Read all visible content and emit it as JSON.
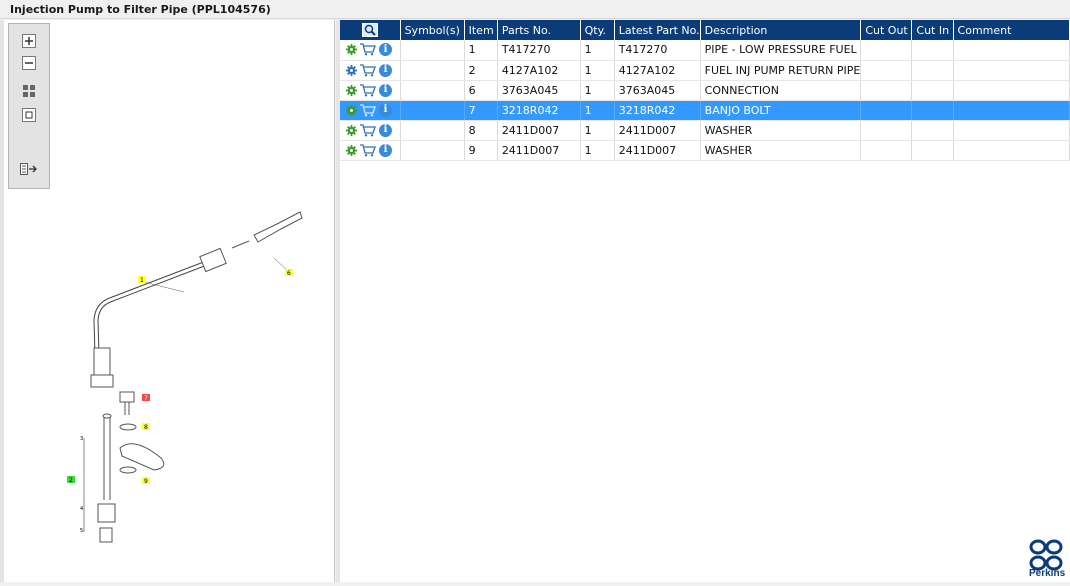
{
  "window": {
    "title": "Injection Pump to Filter Pipe (PPL104576)"
  },
  "zoom_tools": [
    {
      "name": "zoom-in-icon"
    },
    {
      "name": "zoom-out-icon"
    },
    {
      "name": "fit-all-icon"
    },
    {
      "name": "fit-window-icon"
    },
    {
      "name": "export-icon"
    }
  ],
  "diagram": {
    "callouts": [
      "1",
      "6",
      "7",
      "8",
      "9",
      "2",
      "3",
      "4",
      "5"
    ],
    "highlighted_callout": "7",
    "group_callout": "2",
    "colors": {
      "callout_yellow": "#ffff33",
      "callout_red": "#ff4444",
      "callout_green": "#33dd33",
      "line": "#555555"
    }
  },
  "grid": {
    "columns": [
      "",
      "Symbol(s)",
      "Item",
      "Parts No.",
      "Qty.",
      "Latest Part No.",
      "Description",
      "Cut Out",
      "Cut In",
      "Comment"
    ],
    "rows": [
      {
        "gear": "green",
        "symbols": "",
        "item": "1",
        "part_no": "T417270",
        "qty": "1",
        "latest": "T417270",
        "description": "PIPE - LOW PRESSURE FUEL",
        "cut_out": "",
        "cut_in": "",
        "comment": ""
      },
      {
        "gear": "blue",
        "symbols": "",
        "item": "2",
        "part_no": "4127A102",
        "qty": "1",
        "latest": "4127A102",
        "description": "FUEL INJ PUMP RETURN PIPE",
        "cut_out": "",
        "cut_in": "",
        "comment": ""
      },
      {
        "gear": "green",
        "symbols": "",
        "item": "6",
        "part_no": "3763A045",
        "qty": "1",
        "latest": "3763A045",
        "description": "CONNECTION",
        "cut_out": "",
        "cut_in": "",
        "comment": ""
      },
      {
        "gear": "green",
        "symbols": "",
        "item": "7",
        "part_no": "3218R042",
        "qty": "1",
        "latest": "3218R042",
        "description": "BANJO BOLT",
        "cut_out": "",
        "cut_in": "",
        "comment": "",
        "selected": true
      },
      {
        "gear": "green",
        "symbols": "",
        "item": "8",
        "part_no": "2411D007",
        "qty": "1",
        "latest": "2411D007",
        "description": "WASHER",
        "cut_out": "",
        "cut_in": "",
        "comment": ""
      },
      {
        "gear": "green",
        "symbols": "",
        "item": "9",
        "part_no": "2411D007",
        "qty": "1",
        "latest": "2411D007",
        "description": "WASHER",
        "cut_out": "",
        "cut_in": "",
        "comment": ""
      }
    ]
  },
  "colors": {
    "header_bg": "#0b3c7a",
    "selected_row": "#3399ff",
    "brand": "#0b3c7a"
  },
  "brand": {
    "name": "Perkins"
  }
}
